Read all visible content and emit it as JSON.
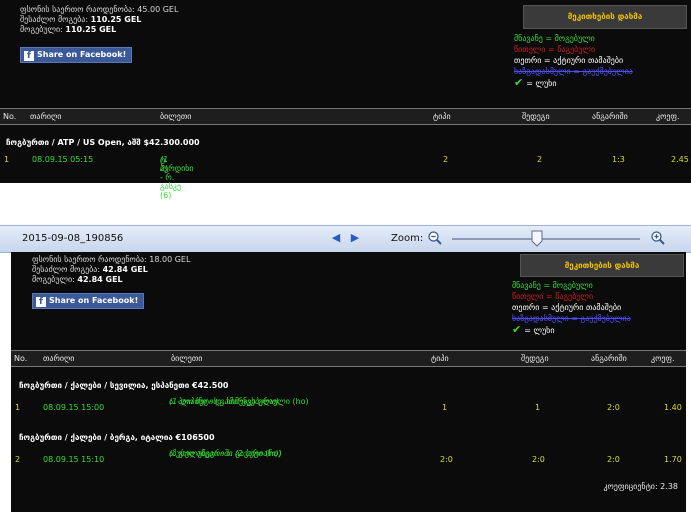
{
  "top": {
    "summary": {
      "stake_line": "ფსონის საერთო რაოდენობა: 45.00 GEL",
      "possible_label": "შესაძლო მოგება:",
      "possible_value": "110.25 GEL",
      "win_label": "მოგებული:",
      "win_value": "110.25 GEL"
    },
    "share_label": "Share on Facebook!",
    "conditions_button": "მეკითხების დახმა",
    "legend": {
      "won": "მნავანე = მოგებული",
      "lost": "წითელი = წაგებული",
      "active": "თეთრი = აქტიური თამაშები",
      "void": "ხაზგადასმული = გაუქმებულია",
      "draw": "= ლუხი"
    },
    "columns": [
      "No.",
      "თარიღი",
      "ბილეთი",
      "ტიპი",
      "შედეგი",
      "ანგარიში",
      "კოეფ."
    ],
    "group": "ჩოგბურთი / ATP / US Open, აშშ $42.300.000",
    "rows": [
      {
        "no": "1",
        "date": "08.09.15 05:15",
        "event": "ტ. ბერდიხი - რ. გასკე (6)",
        "pick": "(1 2)",
        "type": "2",
        "result": "2",
        "score": "1:3",
        "odd": "2.45"
      }
    ]
  },
  "toolbar": {
    "filename": "2015-09-08_190856",
    "zoom_label": "Zoom:",
    "zoom_level": 0.45
  },
  "bottom": {
    "summary": {
      "stake_line": "ფსონის საერთო რაოდენობა: 18.00 GEL",
      "possible_label": "შესაძლო მოგება:",
      "possible_value": "42.84 GEL",
      "win_label": "მოგებული:",
      "win_value": "42.84 GEL"
    },
    "share_label": "Share on Facebook!",
    "conditions_button": "მეკითხების დახმა",
    "legend": {
      "won": "მნავანე = მოგებული",
      "lost": "წითელი = წაგებული",
      "active": "თეთრი = აქტიური თამაშები",
      "void": "ხაზგადასმული = გაუქმებულია",
      "draw": "= ლუხი"
    },
    "columns": [
      "No.",
      "თარიღი",
      "ბილეთი",
      "ტიპი",
      "შედეგი",
      "ანგარიში",
      "კოეფ."
    ],
    "groups": [
      {
        "title": "ჩოგბურთი / ქალები / სევილია, ესპანეთი €42.500",
        "row": {
          "no": "1",
          "date": "08.09.15 15:00",
          "event": "ა. პაიპინი - დ. ხიმენეს გრაელი (ho)",
          "pick": "(1-ლი სეტის გამარჯვებული)",
          "type": "1",
          "result": "1",
          "score": "2:0",
          "odd": "1.40"
        }
      },
      {
        "title": "ჩოგბურთი / ქალები / ბერგა, იტალია €106500",
        "row": {
          "no": "2",
          "date": "08.09.15 15:10",
          "event": "ა. გოლუბევი - ა. გავარი (ho)",
          "pick": "(ზუსტი ანგარიში (2 სეტიანი))",
          "type": "2:0",
          "result": "2:0",
          "score": "2:0",
          "odd": "1.70"
        }
      }
    ],
    "total_odd": "კოეფიციენტი: 2.38"
  }
}
